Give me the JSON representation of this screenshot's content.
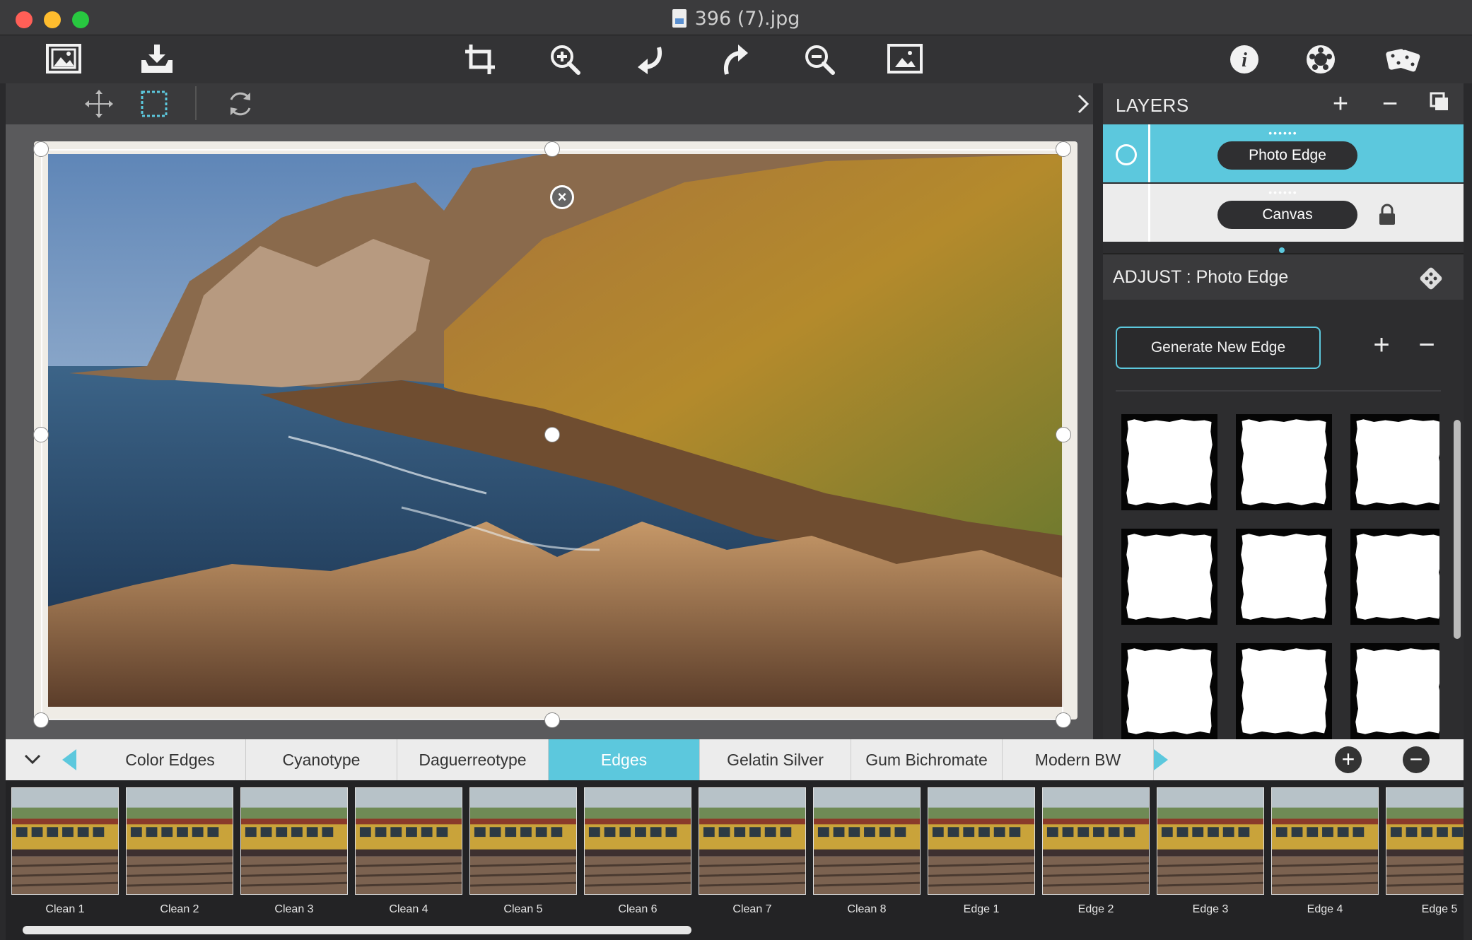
{
  "window": {
    "title": "396 (7).jpg"
  },
  "toolbar": {
    "icons": [
      "open-image-icon",
      "save-icon",
      "crop-icon",
      "zoom-in-icon",
      "undo-icon",
      "redo-icon",
      "zoom-out-icon",
      "fit-image-icon",
      "info-icon",
      "settings-icon",
      "randomize-icon"
    ]
  },
  "subtoolbar": {
    "icons": [
      "move-icon",
      "selection-icon",
      "rotate-icon",
      "expand-panel-icon"
    ]
  },
  "layers": {
    "title": "LAYERS",
    "add_label": "+",
    "remove_label": "−",
    "items": [
      {
        "label": "Photo Edge",
        "selected": true
      },
      {
        "label": "Canvas",
        "locked": true
      }
    ]
  },
  "adjust": {
    "title": "ADJUST : Photo Edge",
    "generate_label": "Generate New Edge",
    "add_label": "+",
    "remove_label": "−"
  },
  "categories": {
    "tabs": [
      "Color Edges",
      "Cyanotype",
      "Daguerreotype",
      "Edges",
      "Gelatin Silver",
      "Gum Bichromate",
      "Modern BW"
    ],
    "active": "Edges",
    "add_label": "+",
    "remove_label": "−"
  },
  "presets": [
    "Clean 1",
    "Clean 2",
    "Clean 3",
    "Clean 4",
    "Clean 5",
    "Clean 6",
    "Clean 7",
    "Clean 8",
    "Edge 1",
    "Edge 2",
    "Edge 3",
    "Edge 4",
    "Edge 5"
  ],
  "colors": {
    "accent": "#5cc8dd",
    "toolbar": "#333335",
    "panel": "#2d2d2f"
  }
}
